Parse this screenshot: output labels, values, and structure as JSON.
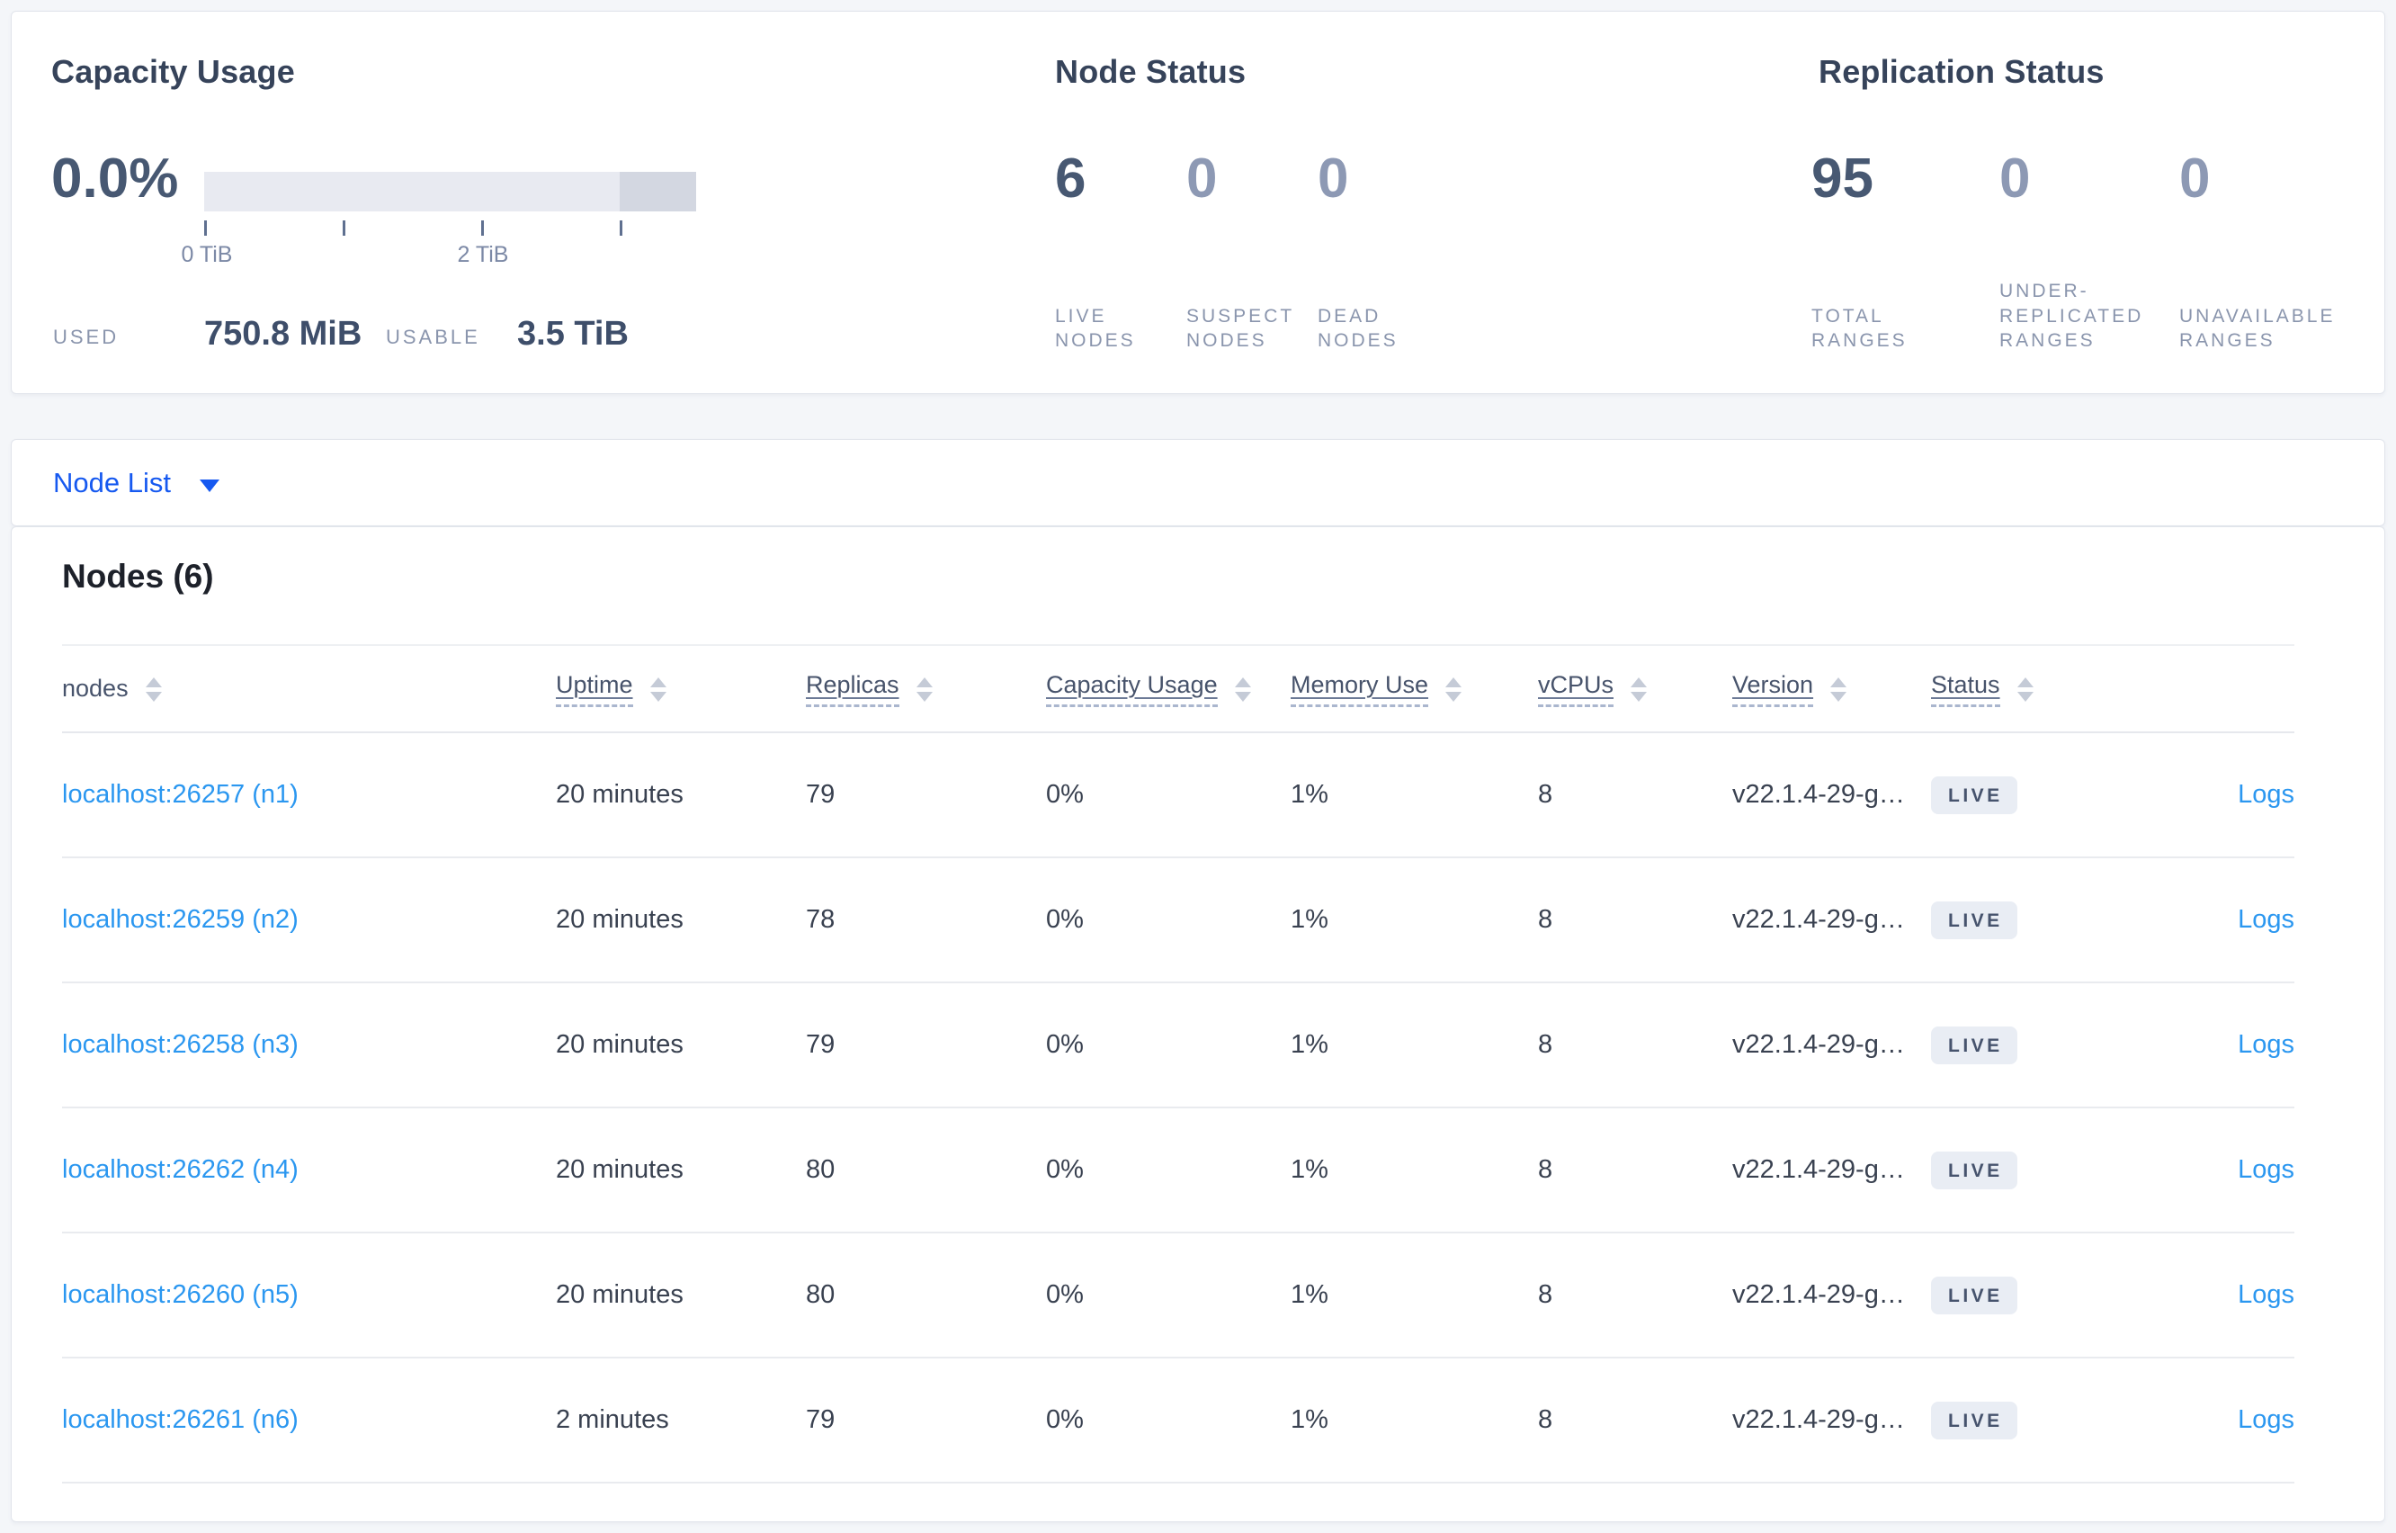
{
  "colors": {
    "page_bg": "#f4f6f9",
    "card_bg": "#ffffff",
    "card_border": "#e2e5ec",
    "title_text": "#36435a",
    "stat_number": "#475872",
    "stat_number_muted": "#8d99b4",
    "stat_label": "#8a95ad",
    "bar_track": "#e8eaf1",
    "bar_tail": "#d3d7e1",
    "tick_label": "#7c89a6",
    "heading_text": "#1d212a",
    "header_text": "#47536b",
    "cell_text": "#394150",
    "link_blue": "#2b97f0",
    "selector_blue": "#1659f0",
    "divider": "#e9ebef",
    "badge_bg": "#e9edf4",
    "badge_text": "#46536d"
  },
  "summary": {
    "capacity": {
      "title": "Capacity Usage",
      "percent": "0.0%",
      "tick_labels": [
        "0 TiB",
        "2 TiB"
      ],
      "used_label": "USED",
      "used_value": "750.8 MiB",
      "usable_label": "USABLE",
      "usable_value": "3.5 TiB"
    },
    "node_status": {
      "title": "Node Status",
      "stats": [
        {
          "value": "6",
          "label": "LIVE\nNODES"
        },
        {
          "value": "0",
          "label": "SUSPECT\nNODES"
        },
        {
          "value": "0",
          "label": "DEAD\nNODES"
        }
      ]
    },
    "replication": {
      "title": "Replication Status",
      "stats": [
        {
          "value": "95",
          "label": "TOTAL\nRANGES"
        },
        {
          "value": "0",
          "label": "UNDER-\nREPLICATED\nRANGES"
        },
        {
          "value": "0",
          "label": "UNAVAILABLE\nRANGES"
        }
      ]
    }
  },
  "view_selector": {
    "label": "Node List"
  },
  "nodes_section": {
    "heading": "Nodes (6)",
    "columns": [
      {
        "label": "nodes",
        "sortable": true,
        "dashed": false
      },
      {
        "label": "Uptime",
        "sortable": true,
        "dashed": true
      },
      {
        "label": "Replicas",
        "sortable": true,
        "dashed": true
      },
      {
        "label": "Capacity Usage",
        "sortable": true,
        "dashed": true
      },
      {
        "label": "Memory Use",
        "sortable": true,
        "dashed": true
      },
      {
        "label": "vCPUs",
        "sortable": true,
        "dashed": true
      },
      {
        "label": "Version",
        "sortable": true,
        "dashed": true
      },
      {
        "label": "Status",
        "sortable": true,
        "dashed": true
      },
      {
        "label": "",
        "sortable": false,
        "dashed": false
      }
    ],
    "rows": [
      {
        "node": "localhost:26257 (n1)",
        "uptime": "20 minutes",
        "replicas": "79",
        "capacity": "0%",
        "memory": "1%",
        "vcpus": "8",
        "version": "v22.1.4-29-g…",
        "status": "LIVE",
        "logs": "Logs"
      },
      {
        "node": "localhost:26259 (n2)",
        "uptime": "20 minutes",
        "replicas": "78",
        "capacity": "0%",
        "memory": "1%",
        "vcpus": "8",
        "version": "v22.1.4-29-g…",
        "status": "LIVE",
        "logs": "Logs"
      },
      {
        "node": "localhost:26258 (n3)",
        "uptime": "20 minutes",
        "replicas": "79",
        "capacity": "0%",
        "memory": "1%",
        "vcpus": "8",
        "version": "v22.1.4-29-g…",
        "status": "LIVE",
        "logs": "Logs"
      },
      {
        "node": "localhost:26262 (n4)",
        "uptime": "20 minutes",
        "replicas": "80",
        "capacity": "0%",
        "memory": "1%",
        "vcpus": "8",
        "version": "v22.1.4-29-g…",
        "status": "LIVE",
        "logs": "Logs"
      },
      {
        "node": "localhost:26260 (n5)",
        "uptime": "20 minutes",
        "replicas": "80",
        "capacity": "0%",
        "memory": "1%",
        "vcpus": "8",
        "version": "v22.1.4-29-g…",
        "status": "LIVE",
        "logs": "Logs"
      },
      {
        "node": "localhost:26261 (n6)",
        "uptime": "2 minutes",
        "replicas": "79",
        "capacity": "0%",
        "memory": "1%",
        "vcpus": "8",
        "version": "v22.1.4-29-g…",
        "status": "LIVE",
        "logs": "Logs"
      }
    ]
  }
}
